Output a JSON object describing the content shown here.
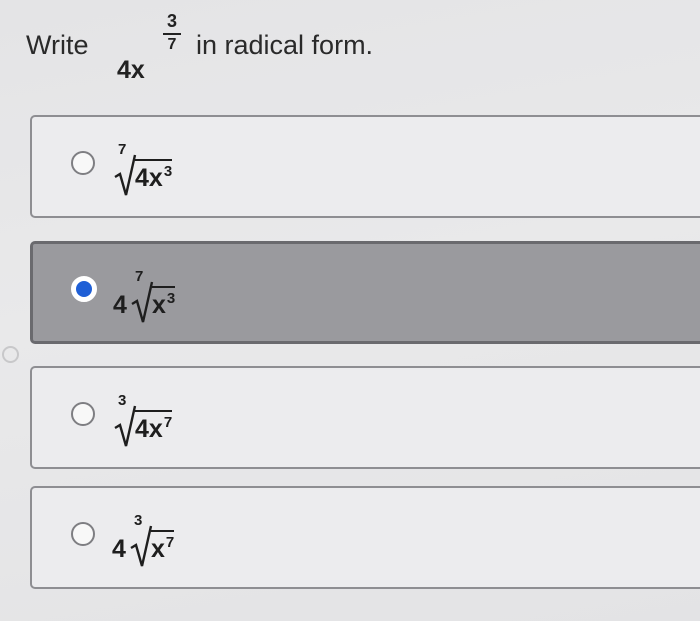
{
  "question": {
    "prefix": "Write",
    "base": "4x",
    "exponent_numerator": "3",
    "exponent_denominator": "7",
    "suffix": "in radical form."
  },
  "options": [
    {
      "coefficient": "",
      "index": "7",
      "radicand": "4x",
      "power": "3",
      "selected": false
    },
    {
      "coefficient": "4",
      "index": "7",
      "radicand": "x",
      "power": "3",
      "selected": true
    },
    {
      "coefficient": "",
      "index": "3",
      "radicand": "4x",
      "power": "7",
      "selected": false
    },
    {
      "coefficient": "4",
      "index": "3",
      "radicand": "x",
      "power": "7",
      "selected": false
    }
  ],
  "colors": {
    "selected_radio": "#1f5fd6",
    "selected_background": "#9a9a9e"
  }
}
